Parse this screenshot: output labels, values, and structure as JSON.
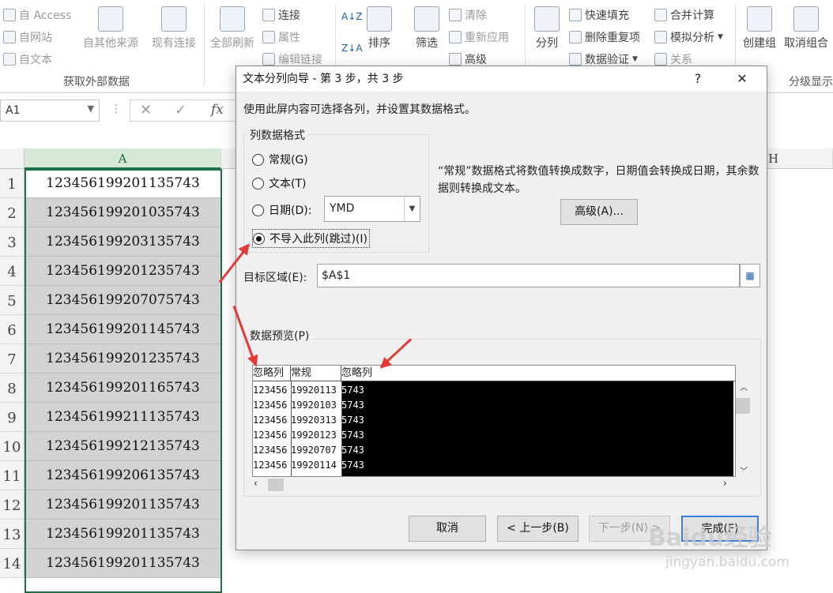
{
  "ribbon": {
    "get_external": {
      "access": "自 Access",
      "web": "自网站",
      "text": "自文本",
      "other_sources": "自其他来源",
      "existing_connections": "现有连接",
      "label": "获取外部数据"
    },
    "connections": {
      "refresh_all": "全部刷新",
      "connections": "连接",
      "properties": "属性",
      "edit_links": "编辑链接"
    },
    "sort_filter": {
      "sort": "排序",
      "filter": "筛选",
      "clear": "清除",
      "reapply": "重新应用",
      "advanced": "高级"
    },
    "data_tools": {
      "text_to_columns": "分列",
      "flash_fill": "快速填充",
      "remove_duplicates": "删除重复项",
      "data_validation": "数据验证",
      "consolidate": "合并计算",
      "what_if": "模拟分析",
      "relationships": "关系"
    },
    "outline": {
      "group": "创建组",
      "ungroup": "取消组合",
      "label": "分级显示"
    }
  },
  "formula_bar": {
    "name_box": "A1",
    "fx": "fx"
  },
  "sheet": {
    "col_a": "A",
    "col_h": "H",
    "rows": [
      {
        "n": "1",
        "v": "123456199201135743"
      },
      {
        "n": "2",
        "v": "123456199201035743"
      },
      {
        "n": "3",
        "v": "123456199203135743"
      },
      {
        "n": "4",
        "v": "123456199201235743"
      },
      {
        "n": "5",
        "v": "123456199207075743"
      },
      {
        "n": "6",
        "v": "123456199201145743"
      },
      {
        "n": "7",
        "v": "123456199201235743"
      },
      {
        "n": "8",
        "v": "123456199201165743"
      },
      {
        "n": "9",
        "v": "123456199211135743"
      },
      {
        "n": "10",
        "v": "123456199212135743"
      },
      {
        "n": "11",
        "v": "123456199206135743"
      },
      {
        "n": "12",
        "v": "123456199201135743"
      },
      {
        "n": "13",
        "v": "123456199201135743"
      },
      {
        "n": "14",
        "v": "123456199201135743"
      }
    ]
  },
  "dialog": {
    "title": "文本分列向导 - 第 3 步，共 3 步",
    "help": "?",
    "close": "✕",
    "instruction": "使用此屏内容可选择各列，并设置其数据格式。",
    "format_group": "列数据格式",
    "opt_general": "常规(G)",
    "opt_text": "文本(T)",
    "opt_date": "日期(D):",
    "date_value": "YMD",
    "opt_skip": "不导入此列(跳过)(I)",
    "description": "“常规”数据格式将数值转换成数字，日期值会转换成日期，其余数据则转换成文本。",
    "advanced_btn": "高级(A)...",
    "dest_label": "目标区域(E):",
    "dest_value": "$A$1",
    "preview_label": "数据预览(P)",
    "preview_headers": [
      "忽略列",
      "常规",
      "忽略列"
    ],
    "preview_rows": [
      [
        "123456",
        "19920113",
        "5743"
      ],
      [
        "123456",
        "19920103",
        "5743"
      ],
      [
        "123456",
        "19920313",
        "5743"
      ],
      [
        "123456",
        "19920123",
        "5743"
      ],
      [
        "123456",
        "19920707",
        "5743"
      ],
      [
        "123456",
        "19920114",
        "5743"
      ]
    ],
    "cancel_btn": "取消",
    "back_btn": "< 上一步(B)",
    "next_btn": "下一步(N) >",
    "finish_btn": "完成(F)"
  },
  "watermark": {
    "brand": "Baidu经验",
    "url": "jingyan.baidu.com"
  },
  "colors": {
    "accent": "#217346",
    "annotation_arrow": "#e53935",
    "selection_border": "#1e7145"
  }
}
